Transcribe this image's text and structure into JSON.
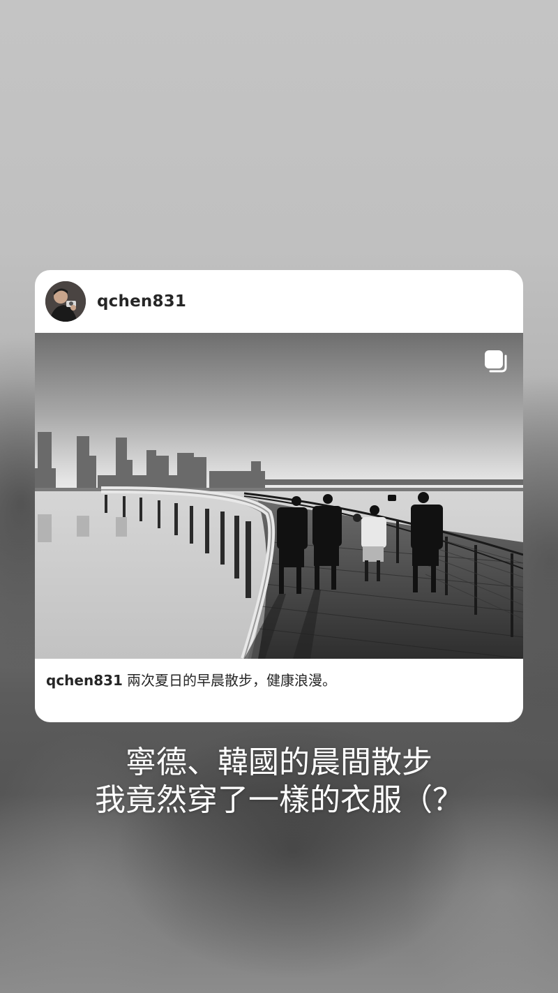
{
  "post": {
    "username": "qchen831",
    "avatar_icon": "profile-photo",
    "multi_photo_icon": "carousel-icon",
    "caption_user": "qchen831",
    "caption_text": "兩次夏日的早晨散步，健康浪漫。"
  },
  "story_text": {
    "line1": "寧德、韓國的晨間散步",
    "line2": "我竟然穿了一樣的衣服（？"
  },
  "colors": {
    "card_background": "#ffffff",
    "text_primary": "#262626",
    "overlay_text": "#ffffff"
  }
}
